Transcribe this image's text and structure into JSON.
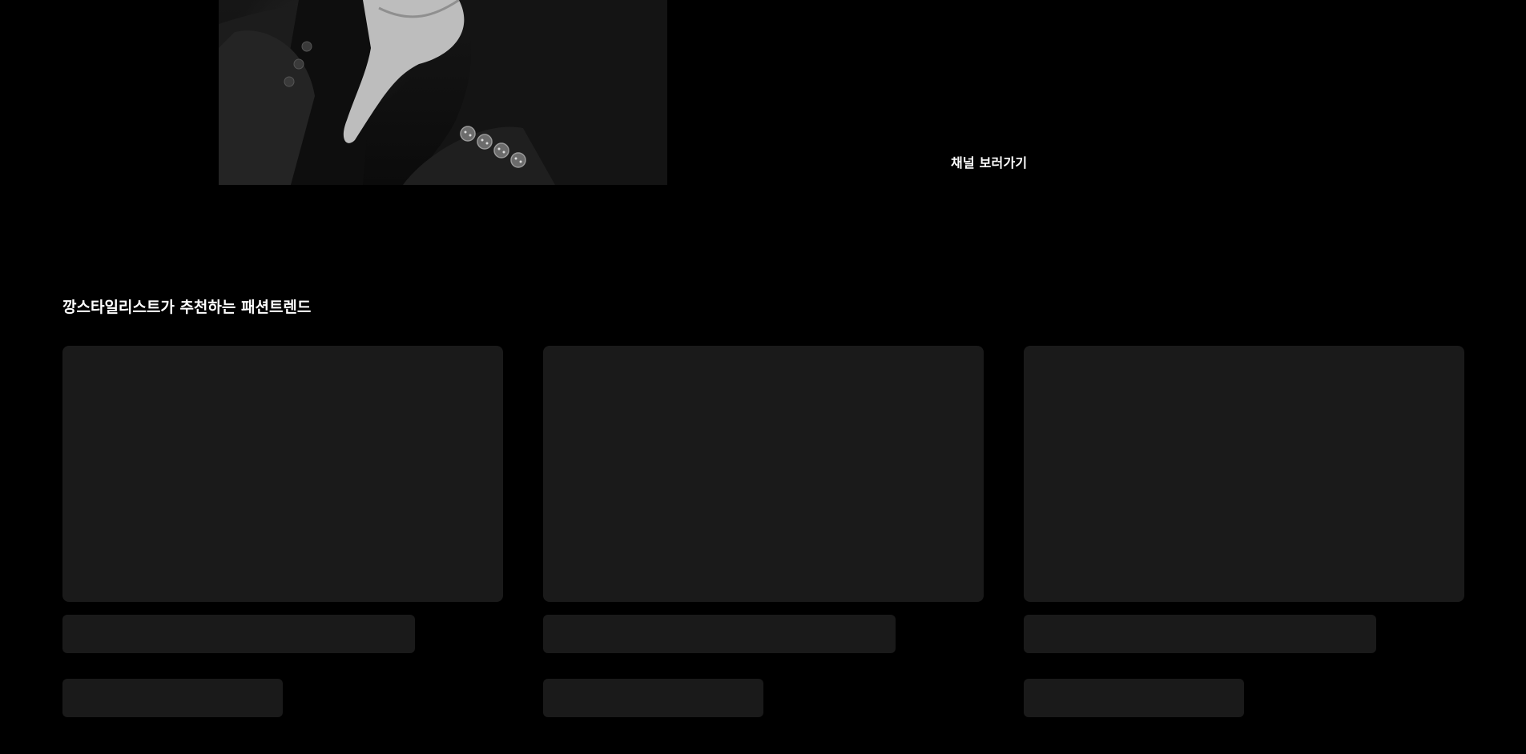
{
  "hero": {
    "image_alt": "suit-sleeve-photo",
    "channel_link_label": "채널 보러가기"
  },
  "trend_section": {
    "title": "깡스타일리스트가 추천하는 패션트렌드",
    "cards": [
      {
        "state": "loading-skeleton"
      },
      {
        "state": "loading-skeleton"
      },
      {
        "state": "loading-skeleton"
      }
    ]
  },
  "colors": {
    "background": "#000000",
    "skeleton": "#1a1a1a",
    "text": "#ffffff"
  }
}
